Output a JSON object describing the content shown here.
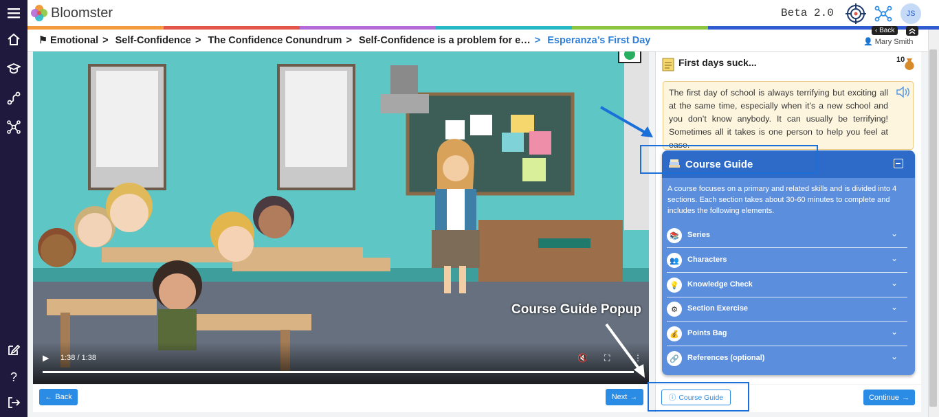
{
  "app": {
    "brand": "Bloomster",
    "version_label": "Beta 2.0",
    "user_initials": "JS",
    "user_name": "Mary Smith"
  },
  "colors": {
    "sidebar": "#1f1a3d",
    "accent": "#2b8ce6",
    "guide_header": "#2e6bc9",
    "guide_body": "#5b8fde",
    "highlight": "#1a6fd8"
  },
  "stripe_colors": [
    "#f29a3c",
    "#e1554b",
    "#b46ad8",
    "#27b8c6",
    "#8cc63f",
    "#2f5bd0"
  ],
  "sidebar_icons": [
    "menu-icon",
    "home-icon",
    "graduation-cap-icon",
    "path-icon",
    "network-icon",
    "edit-icon",
    "help-icon",
    "logout-icon"
  ],
  "breadcrumb": {
    "items": [
      "Emotional",
      "Self-Confidence",
      "The Confidence Conundrum",
      "Self-Confidence is a problem for e…"
    ],
    "current": "Esperanza’s First Day",
    "separator": ">",
    "back_label": "Back"
  },
  "video": {
    "time": "1:38 / 1:38",
    "progress": 1.0
  },
  "nav": {
    "back_label": "Back",
    "next_label": "Next",
    "continue_label": "Continue"
  },
  "panel": {
    "title": "First days suck...",
    "points": "10",
    "body": "The first day of school is always terrifying but exciting all at the same time, especially when it’s a new school and you don’t know anybody. It can usually be terrifying! Sometimes all it takes is one person to help you feel at ease."
  },
  "course_guide": {
    "title": "Course Guide",
    "description": "A course focuses on a primary and related skills and is divided into 4 sections. Each section takes about 30-60 minutes to complete and includes the following elements.",
    "items": [
      {
        "label": "Series",
        "icon": "series-icon"
      },
      {
        "label": "Characters",
        "icon": "characters-icon"
      },
      {
        "label": "Knowledge Check",
        "icon": "lightbulb-icon"
      },
      {
        "label": "Section Exercise",
        "icon": "exercise-icon"
      },
      {
        "label": "Points Bag",
        "icon": "money-bag-icon"
      },
      {
        "label": "References (optional)",
        "icon": "link-icon"
      }
    ],
    "button_label": "Course Guide"
  },
  "annotation": "Course Guide Popup"
}
